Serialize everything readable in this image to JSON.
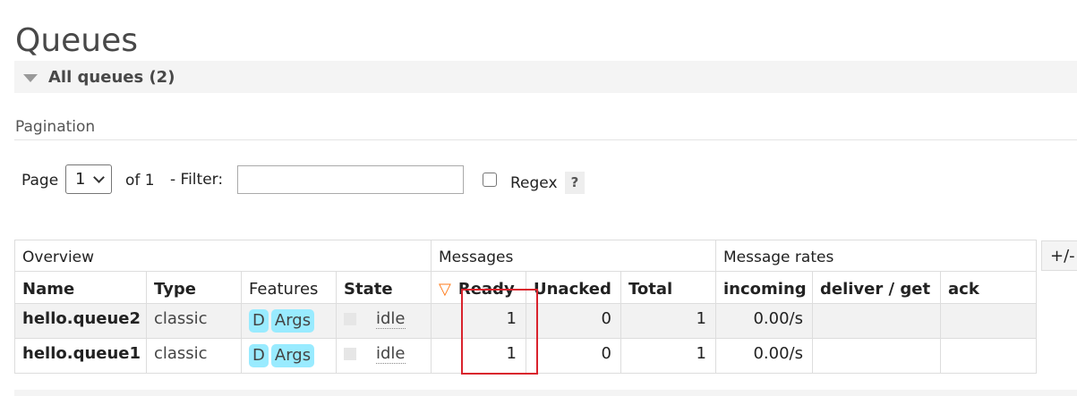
{
  "page": {
    "title": "Queues"
  },
  "section": {
    "label": "All queues (2)"
  },
  "pagination": {
    "title": "Pagination",
    "page_label": "Page",
    "page_value": "1",
    "of_label": "of 1",
    "filter_label": "- Filter:",
    "filter_value": "",
    "regex_label": "Regex",
    "regex_checked": false,
    "help_label": "?"
  },
  "table": {
    "groups": {
      "overview": "Overview",
      "messages": "Messages",
      "rates": "Message rates"
    },
    "columns": {
      "name": "Name",
      "type": "Type",
      "features": "Features",
      "state": "State",
      "ready": "Ready",
      "unacked": "Unacked",
      "total": "Total",
      "incoming": "incoming",
      "deliver_get": "deliver / get",
      "ack": "ack"
    },
    "sort_indicator": "▽",
    "toggle_columns_label": "+/-",
    "rows": [
      {
        "name": "hello.queue2",
        "type": "classic",
        "features": [
          "D",
          "Args"
        ],
        "state": "idle",
        "ready": "1",
        "unacked": "0",
        "total": "1",
        "incoming": "0.00/s",
        "deliver_get": "",
        "ack": ""
      },
      {
        "name": "hello.queue1",
        "type": "classic",
        "features": [
          "D",
          "Args"
        ],
        "state": "idle",
        "ready": "1",
        "unacked": "0",
        "total": "1",
        "incoming": "0.00/s",
        "deliver_get": "",
        "ack": ""
      }
    ]
  },
  "colors": {
    "badge": "#99ebff",
    "highlight": "#d9232d",
    "sort_arrow": "#ff7a18"
  }
}
